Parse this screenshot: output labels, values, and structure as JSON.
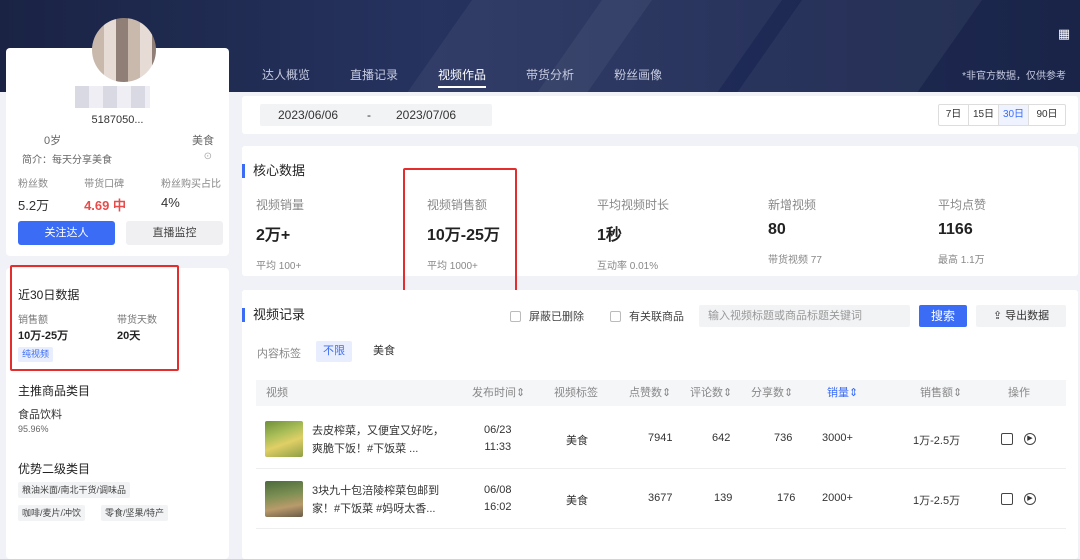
{
  "profile": {
    "uid": "5187050...",
    "age": "0岁",
    "category": "美食",
    "intro": "简介：每天分享美食",
    "intro_icon": "chevron-down-circle-icon",
    "stats": [
      {
        "label": "粉丝数",
        "value": "5.2万"
      },
      {
        "label": "带货口碑",
        "value": "4.69 中"
      },
      {
        "label": "粉丝购买占比",
        "value": "4%"
      }
    ],
    "follow_label": "关注达人",
    "live_monitor_label": "直播监控"
  },
  "side": {
    "recent_title": "近30日数据",
    "sales_label": "销售额",
    "sales_value": "10万-25万",
    "days_label": "带货天数",
    "days_value": "20天",
    "tag": "纯视频",
    "main_cat_title": "主推商品类目",
    "main_cat_name": "食品饮料",
    "main_cat_pct": "95.96%",
    "sub_cat_title": "优势二级类目",
    "chips": [
      "粮油米面/南北干货/调味品",
      "咖啡/麦片/冲饮",
      "零食/坚果/特产"
    ]
  },
  "tabs": [
    "达人概览",
    "直播记录",
    "视频作品",
    "带货分析",
    "粉丝画像"
  ],
  "active_tab": 2,
  "disclaimer": "*非官方数据，仅供参考",
  "date": {
    "start": "2023/06/06",
    "sep": "-",
    "end": "2023/07/06"
  },
  "ranges": [
    "7日",
    "15日",
    "30日",
    "90日"
  ],
  "active_range": 2,
  "core": {
    "title": "核心数据",
    "metrics": [
      {
        "label": "视频销量",
        "value": "2万+",
        "sub": "平均 100+"
      },
      {
        "label": "视频销售额",
        "value": "10万-25万",
        "sub": "平均 1000+"
      },
      {
        "label": "平均视频时长",
        "value": "1秒",
        "sub": "互动率 0.01%"
      },
      {
        "label": "新增视频",
        "value": "80",
        "sub": "带货视频 77"
      },
      {
        "label": "平均点赞",
        "value": "1166",
        "sub": "最高 1.1万"
      }
    ]
  },
  "records": {
    "title": "视频记录",
    "cb_hide_deleted": "屏蔽已删除",
    "cb_related": "有关联商品",
    "search_placeholder": "输入视频标题或商品标题关键词",
    "search_btn": "搜索",
    "export_btn": "导出数据",
    "content_tag_label": "内容标签",
    "content_tags": [
      "不限",
      "美食"
    ],
    "columns": [
      "视频",
      "发布时间",
      "视频标签",
      "点赞数",
      "评论数",
      "分享数",
      "销量",
      "销售额",
      "操作"
    ],
    "rows": [
      {
        "title": "去皮榨菜，又便宜又好吃，爽脆下饭！#下饭菜 ...",
        "date": "06/23",
        "time": "11:33",
        "tag": "美食",
        "likes": "7941",
        "comments": "642",
        "shares": "736",
        "sales": "3000+",
        "revenue": "1万-2.5万"
      },
      {
        "title": "3块九十包涪陵榨菜包邮到家！#下饭菜 #妈呀太香...",
        "date": "06/08",
        "time": "16:02",
        "tag": "美食",
        "likes": "3677",
        "comments": "139",
        "shares": "176",
        "sales": "2000+",
        "revenue": "1万-2.5万"
      }
    ]
  },
  "colors": {
    "accent": "#3b6cf6",
    "highlight_box": "#e42d2d",
    "banner": "#1f2b55",
    "rating_red": "#e94b4b"
  }
}
